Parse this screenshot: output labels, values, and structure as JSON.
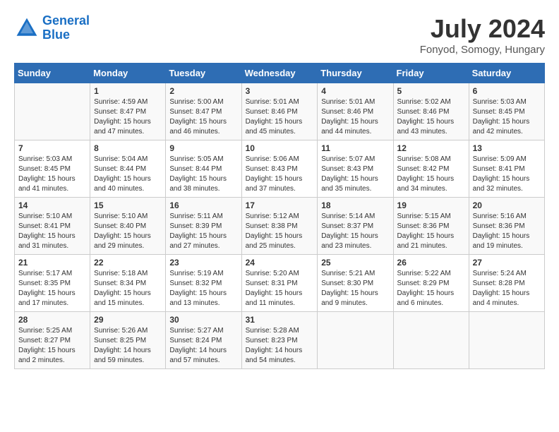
{
  "logo": {
    "line1": "General",
    "line2": "Blue"
  },
  "title": {
    "month_year": "July 2024",
    "location": "Fonyod, Somogy, Hungary"
  },
  "headers": [
    "Sunday",
    "Monday",
    "Tuesday",
    "Wednesday",
    "Thursday",
    "Friday",
    "Saturday"
  ],
  "weeks": [
    [
      {
        "day": "",
        "sunrise": "",
        "sunset": "",
        "daylight": ""
      },
      {
        "day": "1",
        "sunrise": "Sunrise: 4:59 AM",
        "sunset": "Sunset: 8:47 PM",
        "daylight": "Daylight: 15 hours and 47 minutes."
      },
      {
        "day": "2",
        "sunrise": "Sunrise: 5:00 AM",
        "sunset": "Sunset: 8:47 PM",
        "daylight": "Daylight: 15 hours and 46 minutes."
      },
      {
        "day": "3",
        "sunrise": "Sunrise: 5:01 AM",
        "sunset": "Sunset: 8:46 PM",
        "daylight": "Daylight: 15 hours and 45 minutes."
      },
      {
        "day": "4",
        "sunrise": "Sunrise: 5:01 AM",
        "sunset": "Sunset: 8:46 PM",
        "daylight": "Daylight: 15 hours and 44 minutes."
      },
      {
        "day": "5",
        "sunrise": "Sunrise: 5:02 AM",
        "sunset": "Sunset: 8:46 PM",
        "daylight": "Daylight: 15 hours and 43 minutes."
      },
      {
        "day": "6",
        "sunrise": "Sunrise: 5:03 AM",
        "sunset": "Sunset: 8:45 PM",
        "daylight": "Daylight: 15 hours and 42 minutes."
      }
    ],
    [
      {
        "day": "7",
        "sunrise": "Sunrise: 5:03 AM",
        "sunset": "Sunset: 8:45 PM",
        "daylight": "Daylight: 15 hours and 41 minutes."
      },
      {
        "day": "8",
        "sunrise": "Sunrise: 5:04 AM",
        "sunset": "Sunset: 8:44 PM",
        "daylight": "Daylight: 15 hours and 40 minutes."
      },
      {
        "day": "9",
        "sunrise": "Sunrise: 5:05 AM",
        "sunset": "Sunset: 8:44 PM",
        "daylight": "Daylight: 15 hours and 38 minutes."
      },
      {
        "day": "10",
        "sunrise": "Sunrise: 5:06 AM",
        "sunset": "Sunset: 8:43 PM",
        "daylight": "Daylight: 15 hours and 37 minutes."
      },
      {
        "day": "11",
        "sunrise": "Sunrise: 5:07 AM",
        "sunset": "Sunset: 8:43 PM",
        "daylight": "Daylight: 15 hours and 35 minutes."
      },
      {
        "day": "12",
        "sunrise": "Sunrise: 5:08 AM",
        "sunset": "Sunset: 8:42 PM",
        "daylight": "Daylight: 15 hours and 34 minutes."
      },
      {
        "day": "13",
        "sunrise": "Sunrise: 5:09 AM",
        "sunset": "Sunset: 8:41 PM",
        "daylight": "Daylight: 15 hours and 32 minutes."
      }
    ],
    [
      {
        "day": "14",
        "sunrise": "Sunrise: 5:10 AM",
        "sunset": "Sunset: 8:41 PM",
        "daylight": "Daylight: 15 hours and 31 minutes."
      },
      {
        "day": "15",
        "sunrise": "Sunrise: 5:10 AM",
        "sunset": "Sunset: 8:40 PM",
        "daylight": "Daylight: 15 hours and 29 minutes."
      },
      {
        "day": "16",
        "sunrise": "Sunrise: 5:11 AM",
        "sunset": "Sunset: 8:39 PM",
        "daylight": "Daylight: 15 hours and 27 minutes."
      },
      {
        "day": "17",
        "sunrise": "Sunrise: 5:12 AM",
        "sunset": "Sunset: 8:38 PM",
        "daylight": "Daylight: 15 hours and 25 minutes."
      },
      {
        "day": "18",
        "sunrise": "Sunrise: 5:14 AM",
        "sunset": "Sunset: 8:37 PM",
        "daylight": "Daylight: 15 hours and 23 minutes."
      },
      {
        "day": "19",
        "sunrise": "Sunrise: 5:15 AM",
        "sunset": "Sunset: 8:36 PM",
        "daylight": "Daylight: 15 hours and 21 minutes."
      },
      {
        "day": "20",
        "sunrise": "Sunrise: 5:16 AM",
        "sunset": "Sunset: 8:36 PM",
        "daylight": "Daylight: 15 hours and 19 minutes."
      }
    ],
    [
      {
        "day": "21",
        "sunrise": "Sunrise: 5:17 AM",
        "sunset": "Sunset: 8:35 PM",
        "daylight": "Daylight: 15 hours and 17 minutes."
      },
      {
        "day": "22",
        "sunrise": "Sunrise: 5:18 AM",
        "sunset": "Sunset: 8:34 PM",
        "daylight": "Daylight: 15 hours and 15 minutes."
      },
      {
        "day": "23",
        "sunrise": "Sunrise: 5:19 AM",
        "sunset": "Sunset: 8:32 PM",
        "daylight": "Daylight: 15 hours and 13 minutes."
      },
      {
        "day": "24",
        "sunrise": "Sunrise: 5:20 AM",
        "sunset": "Sunset: 8:31 PM",
        "daylight": "Daylight: 15 hours and 11 minutes."
      },
      {
        "day": "25",
        "sunrise": "Sunrise: 5:21 AM",
        "sunset": "Sunset: 8:30 PM",
        "daylight": "Daylight: 15 hours and 9 minutes."
      },
      {
        "day": "26",
        "sunrise": "Sunrise: 5:22 AM",
        "sunset": "Sunset: 8:29 PM",
        "daylight": "Daylight: 15 hours and 6 minutes."
      },
      {
        "day": "27",
        "sunrise": "Sunrise: 5:24 AM",
        "sunset": "Sunset: 8:28 PM",
        "daylight": "Daylight: 15 hours and 4 minutes."
      }
    ],
    [
      {
        "day": "28",
        "sunrise": "Sunrise: 5:25 AM",
        "sunset": "Sunset: 8:27 PM",
        "daylight": "Daylight: 15 hours and 2 minutes."
      },
      {
        "day": "29",
        "sunrise": "Sunrise: 5:26 AM",
        "sunset": "Sunset: 8:25 PM",
        "daylight": "Daylight: 14 hours and 59 minutes."
      },
      {
        "day": "30",
        "sunrise": "Sunrise: 5:27 AM",
        "sunset": "Sunset: 8:24 PM",
        "daylight": "Daylight: 14 hours and 57 minutes."
      },
      {
        "day": "31",
        "sunrise": "Sunrise: 5:28 AM",
        "sunset": "Sunset: 8:23 PM",
        "daylight": "Daylight: 14 hours and 54 minutes."
      },
      {
        "day": "",
        "sunrise": "",
        "sunset": "",
        "daylight": ""
      },
      {
        "day": "",
        "sunrise": "",
        "sunset": "",
        "daylight": ""
      },
      {
        "day": "",
        "sunrise": "",
        "sunset": "",
        "daylight": ""
      }
    ]
  ]
}
